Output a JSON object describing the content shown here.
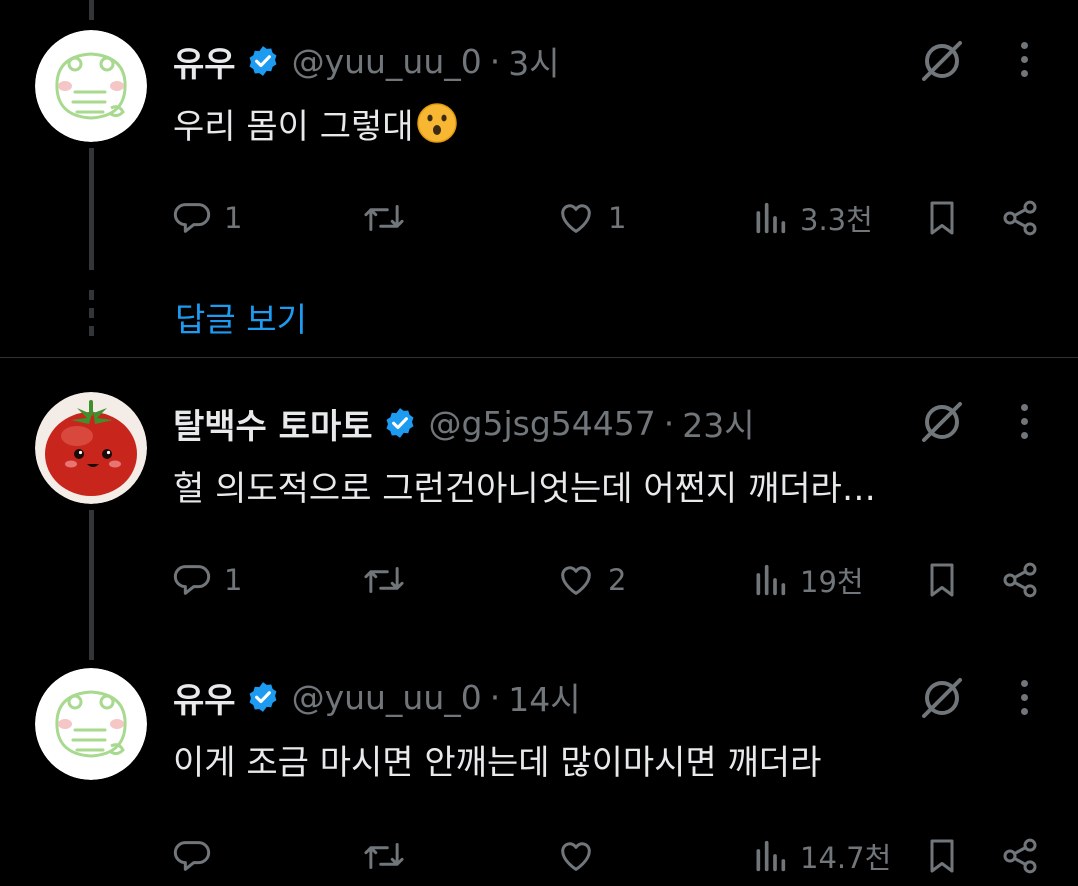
{
  "show_replies_label": "답글 보기",
  "colors": {
    "accent": "#1d9bf0",
    "muted": "#71767b",
    "text": "#e7e9ea"
  },
  "tweets": [
    {
      "name": "유우",
      "handle": "@yuu_uu_0",
      "time": "3시",
      "text": "우리 몸이 그렇대",
      "emoji": "hushed-face-emoji",
      "avatar": "frog-avatar",
      "replies": "1",
      "reposts": "",
      "likes": "1",
      "views": "3.3천"
    },
    {
      "name": "탈백수 토마토",
      "handle": "@g5jsg54457",
      "time": "23시",
      "text": "헐 의도적으로 그런건아니엇는데 어쩐지 깨더라…",
      "avatar": "tomato-avatar",
      "replies": "1",
      "reposts": "",
      "likes": "2",
      "views": "19천"
    },
    {
      "name": "유우",
      "handle": "@yuu_uu_0",
      "time": "14시",
      "text": "이게 조금 마시면 안깨는데 많이마시면 깨더라",
      "avatar": "frog-avatar",
      "replies": "",
      "reposts": "",
      "likes": "",
      "views": "14.7천"
    }
  ]
}
